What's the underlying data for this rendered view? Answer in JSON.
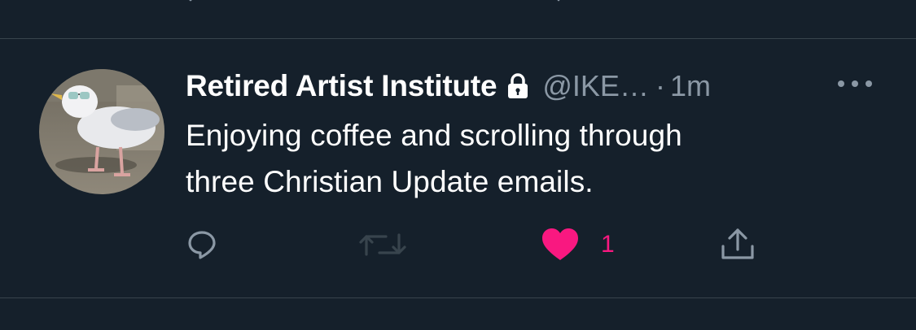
{
  "tweet": {
    "display_name": "Retired Artist Institute",
    "handle": "@IKE…",
    "separator": "·",
    "time": "1m",
    "text_lines": [
      "Enjoying coffee and scrolling through",
      "three Christian Update emails."
    ],
    "actions": {
      "like_count": "1"
    },
    "liked": true
  },
  "colors": {
    "background": "#15202b",
    "divider": "#38444d",
    "muted": "#8b98a5",
    "like": "#f91880",
    "text": "#ffffff"
  },
  "icons": {
    "verified_protected": "lock-icon",
    "more": "more-icon",
    "reply": "reply-icon",
    "retweet": "retweet-icon",
    "like": "heart-icon",
    "share": "share-icon"
  }
}
